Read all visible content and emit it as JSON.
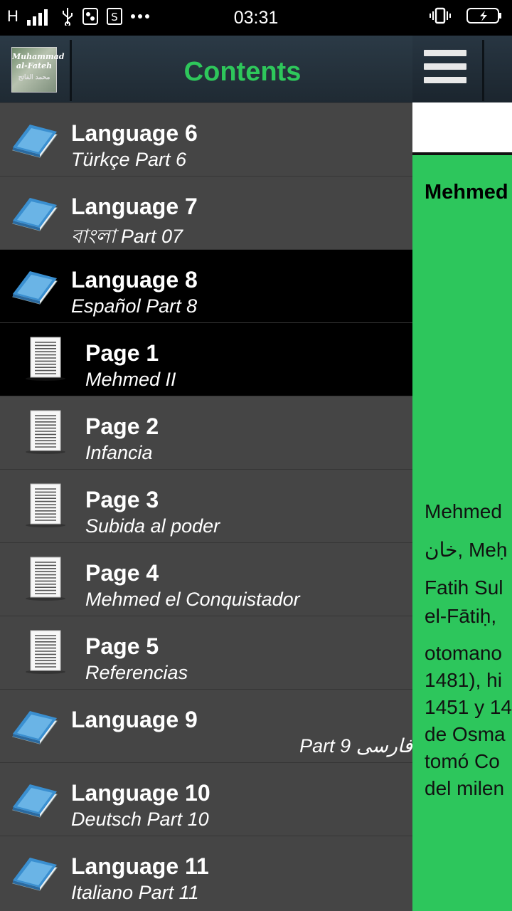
{
  "status_bar": {
    "network": "H",
    "time": "03:31"
  },
  "drawer": {
    "title": "Contents",
    "logo_text_line1": "Muhammad",
    "logo_text_line2": "al-Fateh",
    "logo_text_line3": "محمد الفاتح",
    "items": [
      {
        "title": "Language 6",
        "subtitle": "Türkçe Part 6",
        "type": "book",
        "selected": false
      },
      {
        "title": "Language 7",
        "subtitle": "বাংলা Part 07",
        "type": "book",
        "selected": false
      },
      {
        "title": "Language 8",
        "subtitle": "Español Part 8",
        "type": "book",
        "selected": true
      },
      {
        "title": "Page 1",
        "subtitle": "Mehmed II",
        "type": "page",
        "selected": true
      },
      {
        "title": "Page 2",
        "subtitle": "Infancia",
        "type": "page",
        "selected": false
      },
      {
        "title": "Page 3",
        "subtitle": "Subida al poder",
        "type": "page",
        "selected": false
      },
      {
        "title": "Page 4",
        "subtitle": "Mehmed el Conquistador",
        "type": "page",
        "selected": false
      },
      {
        "title": "Page 5",
        "subtitle": "Referencias",
        "type": "page",
        "selected": false
      },
      {
        "title": "Language 9",
        "subtitle": "فارسی Part 9",
        "type": "book",
        "selected": false,
        "rtl": true
      },
      {
        "title": "Language 10",
        "subtitle": "Deutsch Part 10",
        "type": "book",
        "selected": false
      },
      {
        "title": "Language 11",
        "subtitle": "Italiano Part 11",
        "type": "book",
        "selected": false
      }
    ]
  },
  "main": {
    "heading": "Mehmed",
    "lines": [
      "Mehmed",
      "خان, Meḥ",
      "Fatih Sul",
      "el-Fātiḥ, ",
      "otomano",
      "1481), hi",
      "1451 y 14",
      "de Osma",
      "tomó Co",
      "del milen"
    ]
  },
  "colors": {
    "accent_green": "#2dc65c",
    "drawer_bg": "#454545",
    "selected_bg": "#000000"
  }
}
